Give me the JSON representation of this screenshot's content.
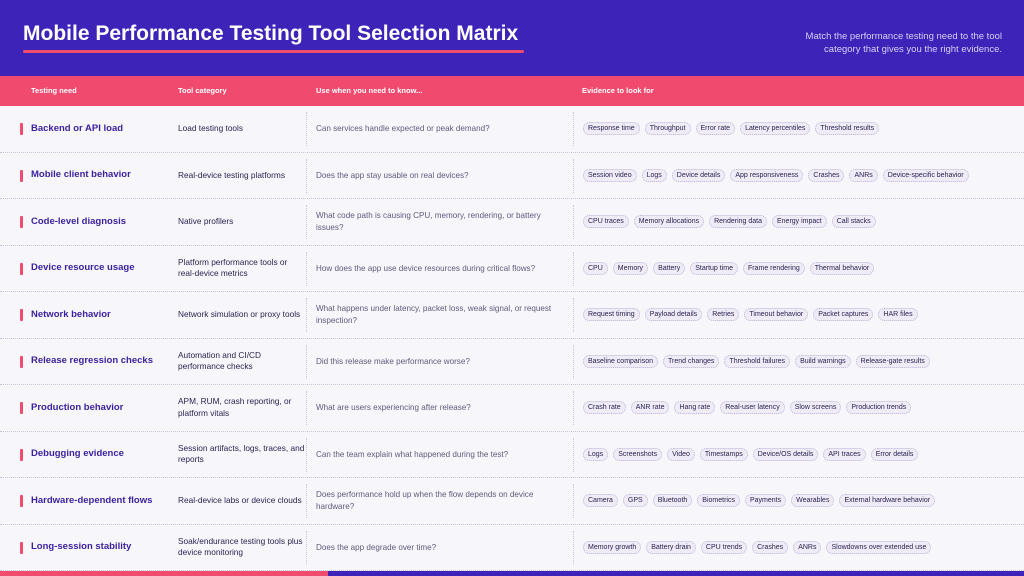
{
  "header": {
    "title": "Mobile Performance Testing Tool Selection Matrix",
    "subtitle": "Match the performance testing need to the tool category that gives you the right evidence."
  },
  "columns": {
    "need": "Testing need",
    "category": "Tool category",
    "use": "Use when you need to know...",
    "evidence": "Evidence to look for"
  },
  "rows": [
    {
      "need": "Backend or API load",
      "category": "Load testing tools",
      "use": "Can services handle expected or peak demand?",
      "evidence": [
        "Response time",
        "Throughput",
        "Error rate",
        "Latency percentiles",
        "Threshold results"
      ]
    },
    {
      "need": "Mobile client behavior",
      "category": "Real-device testing platforms",
      "use": "Does the app stay usable on real devices?",
      "evidence": [
        "Session video",
        "Logs",
        "Device details",
        "App responsiveness",
        "Crashes",
        "ANRs",
        "Device-specific behavior"
      ]
    },
    {
      "need": "Code-level diagnosis",
      "category": "Native profilers",
      "use": "What code path is causing CPU, memory, rendering, or battery issues?",
      "evidence": [
        "CPU traces",
        "Memory allocations",
        "Rendering data",
        "Energy impact",
        "Call stacks"
      ]
    },
    {
      "need": "Device resource usage",
      "category": "Platform performance tools or real-device metrics",
      "use": "How does the app use device resources during critical flows?",
      "evidence": [
        "CPU",
        "Memory",
        "Battery",
        "Startup time",
        "Frame rendering",
        "Thermal behavior"
      ]
    },
    {
      "need": "Network behavior",
      "category": "Network simulation or proxy tools",
      "use": "What happens under latency, packet loss, weak signal, or request inspection?",
      "evidence": [
        "Request timing",
        "Payload details",
        "Retries",
        "Timeout behavior",
        "Packet captures",
        "HAR files"
      ]
    },
    {
      "need": "Release regression checks",
      "category": "Automation and CI/CD performance checks",
      "use": "Did this release make performance worse?",
      "evidence": [
        "Baseline comparison",
        "Trend changes",
        "Threshold failures",
        "Build warnings",
        "Release-gate results"
      ]
    },
    {
      "need": "Production behavior",
      "category": "APM, RUM, crash reporting, or platform vitals",
      "use": "What are users experiencing after release?",
      "evidence": [
        "Crash rate",
        "ANR rate",
        "Hang rate",
        "Real-user latency",
        "Slow screens",
        "Production trends"
      ]
    },
    {
      "need": "Debugging evidence",
      "category": "Session artifacts, logs, traces, and reports",
      "use": "Can the team explain what happened during the test?",
      "evidence": [
        "Logs",
        "Screenshots",
        "Video",
        "Timestamps",
        "Device/OS details",
        "API traces",
        "Error details"
      ]
    },
    {
      "need": "Hardware-dependent flows",
      "category": "Real-device labs or device clouds",
      "use": "Does performance hold up when the flow depends on device hardware?",
      "evidence": [
        "Camera",
        "GPS",
        "Bluetooth",
        "Biometrics",
        "Payments",
        "Wearables",
        "External hardware behavior"
      ]
    },
    {
      "need": "Long-session stability",
      "category": "Soak/endurance testing tools plus device monitoring",
      "use": "Does the app degrade over time?",
      "evidence": [
        "Memory growth",
        "Battery drain",
        "CPU trends",
        "Crashes",
        "ANRs",
        "Slowdowns over extended use"
      ]
    }
  ]
}
